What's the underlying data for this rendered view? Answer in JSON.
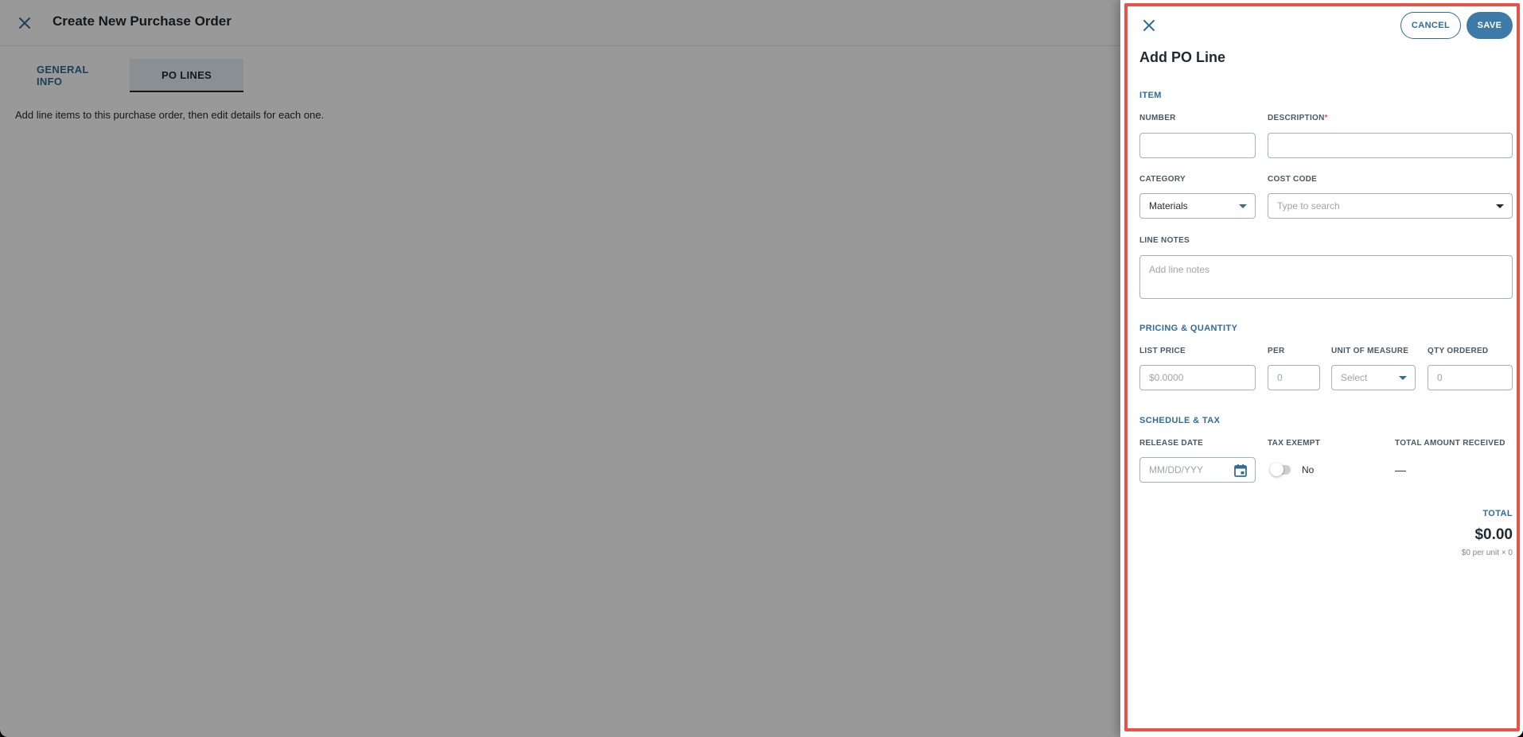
{
  "page": {
    "close_icon": "close-icon",
    "title": "Create New Purchase Order",
    "tabs": [
      {
        "label": "GENERAL INFO"
      },
      {
        "label": "PO LINES"
      }
    ],
    "active_tab": "PO LINES",
    "help_text": "Add line items to this purchase order, then edit details for each one."
  },
  "drawer": {
    "title": "Add PO Line",
    "cancel_label": "CANCEL",
    "save_label": "SAVE",
    "item": {
      "section_title": "ITEM",
      "number_label": "NUMBER",
      "number_value": "",
      "description_label": "DESCRIPTION",
      "required_mark": "*",
      "description_value": "",
      "category_label": "CATEGORY",
      "category_value": "Materials",
      "cost_code_label": "COST CODE",
      "cost_code_placeholder": "Type to search",
      "line_notes_label": "LINE NOTES",
      "line_notes_placeholder": "Add line notes"
    },
    "pricing": {
      "section_title": "PRICING & QUANTITY",
      "list_price_label": "LIST PRICE",
      "list_price_placeholder": "$0.0000",
      "per_label": "PER",
      "per_placeholder": "0",
      "uom_label": "UNIT OF MEASURE",
      "uom_placeholder": "Select",
      "qty_label": "QTY ORDERED",
      "qty_placeholder": "0"
    },
    "schedule": {
      "section_title": "SCHEDULE & TAX",
      "release_date_label": "RELEASE DATE",
      "release_date_placeholder": "MM/DD/YYY",
      "tax_exempt_label": "TAX EXEMPT",
      "tax_exempt_value": "No",
      "tax_exempt_on": false,
      "total_received_label": "TOTAL AMOUNT RECEIVED",
      "total_received_value": "—"
    },
    "total": {
      "label": "TOTAL",
      "value": "$0.00",
      "breakdown": "$0 per unit × 0"
    }
  },
  "colors": {
    "accent": "#2f6c97",
    "primary_button": "#3d7aa8",
    "required": "#e5534b",
    "highlight_border": "#e5534b"
  }
}
